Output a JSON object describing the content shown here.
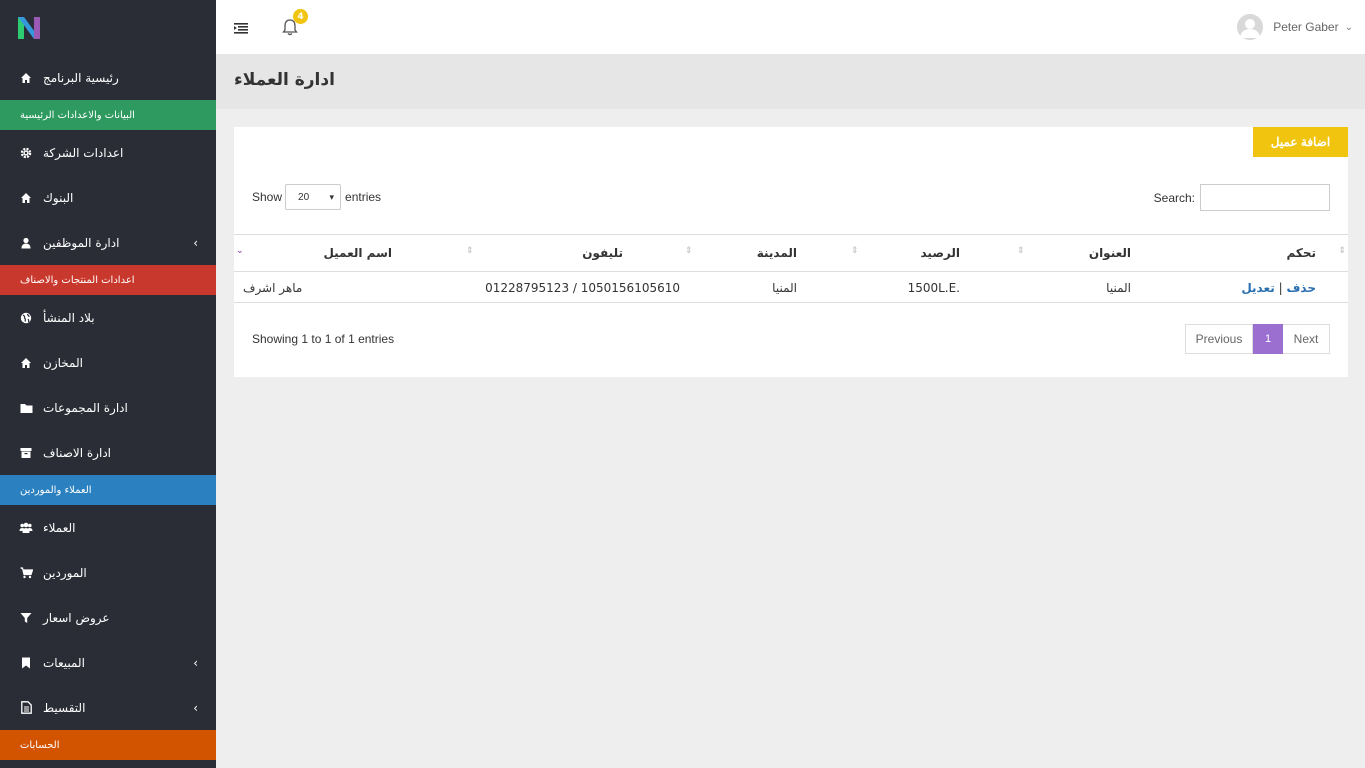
{
  "sidebar": {
    "items": [
      {
        "label": "رئيسية البرنامج",
        "icon": "home-icon"
      },
      {
        "section": "البيانات والاعدادات الرئيسية",
        "color": "#2e9a5f"
      },
      {
        "label": "اعدادات الشركة",
        "icon": "gear-icon"
      },
      {
        "label": "البنوك",
        "icon": "home-icon"
      },
      {
        "label": "ادارة الموظفين",
        "icon": "user-icon",
        "chevron": "‹"
      },
      {
        "section": "اعدادات المنتجات والاصناف",
        "color": "#c9382c"
      },
      {
        "label": "بلاد المنشأ",
        "icon": "globe-icon"
      },
      {
        "label": "المخازن",
        "icon": "home-icon"
      },
      {
        "label": "ادارة المجموعات",
        "icon": "folder-icon"
      },
      {
        "label": "ادارة الاصناف",
        "icon": "archive-icon"
      },
      {
        "section": "العملاء والموردين",
        "color": "#2b80c0"
      },
      {
        "label": "العملاء",
        "icon": "users-icon"
      },
      {
        "label": "الموردين",
        "icon": "cart-icon"
      },
      {
        "label": "عروض اسعار",
        "icon": "filter-icon"
      },
      {
        "label": "المبيعات",
        "icon": "bookmark-icon",
        "chevron": "‹"
      },
      {
        "label": "التقسيط",
        "icon": "document-icon",
        "chevron": "‹"
      },
      {
        "section": "الحسابات",
        "color": "#d35400"
      }
    ]
  },
  "topbar": {
    "notification_count": "4",
    "user_name": "Peter Gaber",
    "user_chevron": "⌄"
  },
  "page": {
    "title": "ادارة العملاء"
  },
  "card": {
    "add_button": "اضافة عميل",
    "show_label": "Show",
    "entries_label": "entries",
    "page_length": "20",
    "select_arrow": "▾",
    "search_label": "Search:",
    "search_value": ""
  },
  "table": {
    "columns": [
      "تحكم",
      "العنوان",
      "الرصيد",
      "المدينة",
      "تليفون",
      "اسم العميل"
    ],
    "sort_icon": "⇕",
    "sort_active_icon": "⌄",
    "rows": [
      {
        "edit": "تعديل",
        "sep": "|",
        "delete": "حذف",
        "address": "المنيا",
        "balance": "1500L.E.",
        "city": "المنيا",
        "phone": "01228795123 / 1050156105610",
        "name": "ماهر اشرف"
      }
    ]
  },
  "footer": {
    "info": "Showing 1 to 1 of 1 entries",
    "prev": "Previous",
    "current": "1",
    "next": "Next"
  },
  "colors": {
    "sidebar_bg": "#2b2d36",
    "accent_yellow": "#f1c40f",
    "accent_purple": "#9b6fd0",
    "link_blue": "#2a6fb0"
  }
}
